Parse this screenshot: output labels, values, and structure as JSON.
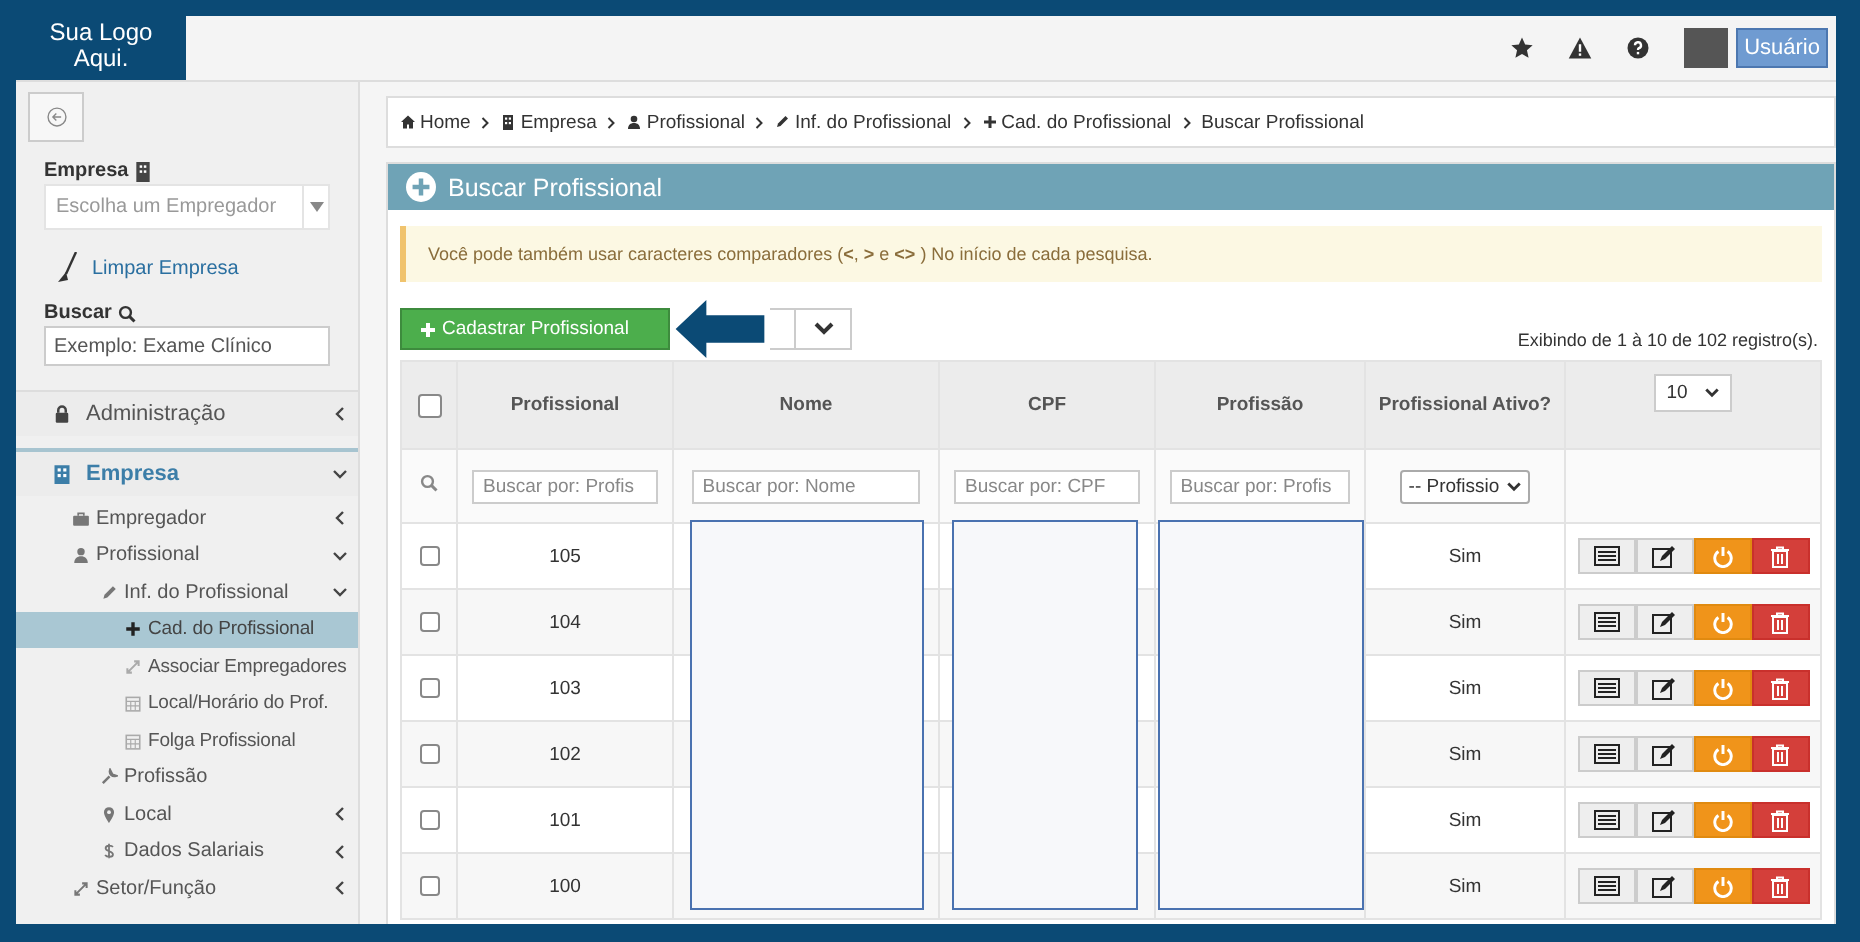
{
  "logo": {
    "text": "Sua Logo Aqui."
  },
  "topbar": {
    "user_button": "Usuário"
  },
  "sidebar": {
    "company_label": "Empresa",
    "company_select": {
      "placeholder": "Escolha um Empregador"
    },
    "clear_link": "Limpar Empresa",
    "search_label": "Buscar",
    "search_field": {
      "placeholder": "Exemplo: Exame Clínico"
    },
    "menu": [
      {
        "label": "Administração",
        "expanded": false,
        "selected": false
      },
      {
        "label": "Empresa",
        "expanded": true,
        "selected": false,
        "children": [
          {
            "label": "Empregador",
            "expanded": false,
            "selected": false
          },
          {
            "label": "Profissional",
            "expanded": true,
            "selected": false,
            "children": [
              {
                "label": "Inf. do Profissional",
                "expanded": true,
                "selected": false,
                "children": [
                  {
                    "label": "Cad. do Profissional",
                    "selected": true
                  },
                  {
                    "label": "Associar Empregadores",
                    "selected": false
                  },
                  {
                    "label": "Local/Horário do Prof.",
                    "selected": false
                  },
                  {
                    "label": "Folga Profissional",
                    "selected": false
                  }
                ]
              },
              {
                "label": "Profissão",
                "selected": false
              },
              {
                "label": "Local",
                "expanded": false,
                "selected": false
              },
              {
                "label": "Dados Salariais",
                "expanded": false,
                "selected": false
              }
            ]
          },
          {
            "label": "Setor/Função",
            "expanded": false,
            "selected": false
          }
        ]
      }
    ]
  },
  "breadcrumb": [
    "Home",
    "Empresa",
    "Profissional",
    "Inf. do Profissional",
    "Cad. do Profissional",
    "Buscar Profissional"
  ],
  "panel": {
    "title": "Buscar Profissional",
    "alert": "Você pode também usar caracteres comparadores (**<**, **>** e **<>** ) No início de cada pesquisa.",
    "add_button": "Cadastrar Profissional",
    "records_info": "Exibindo de 1 à 10 de 102 registro(s).",
    "page_size": "10",
    "table": {
      "select_all_checked": false,
      "columns": [
        "Profissional",
        "Nome",
        "CPF",
        "Profissão",
        "Profissional Ativo?"
      ],
      "filters": [
        {
          "placeholder": "Buscar por: Profis"
        },
        {
          "placeholder": "Buscar por: Nome"
        },
        {
          "placeholder": "Buscar por: CPF"
        },
        {
          "placeholder": "Buscar por: Profis"
        }
      ],
      "status_filter": "-- Profissio",
      "rows": [
        {
          "id": "105",
          "active": "Sim",
          "checked": false
        },
        {
          "id": "104",
          "active": "Sim",
          "checked": false
        },
        {
          "id": "103",
          "active": "Sim",
          "checked": false
        },
        {
          "id": "102",
          "active": "Sim",
          "checked": false
        },
        {
          "id": "101",
          "active": "Sim",
          "checked": false
        },
        {
          "id": "100",
          "active": "Sim",
          "checked": false
        }
      ]
    }
  }
}
